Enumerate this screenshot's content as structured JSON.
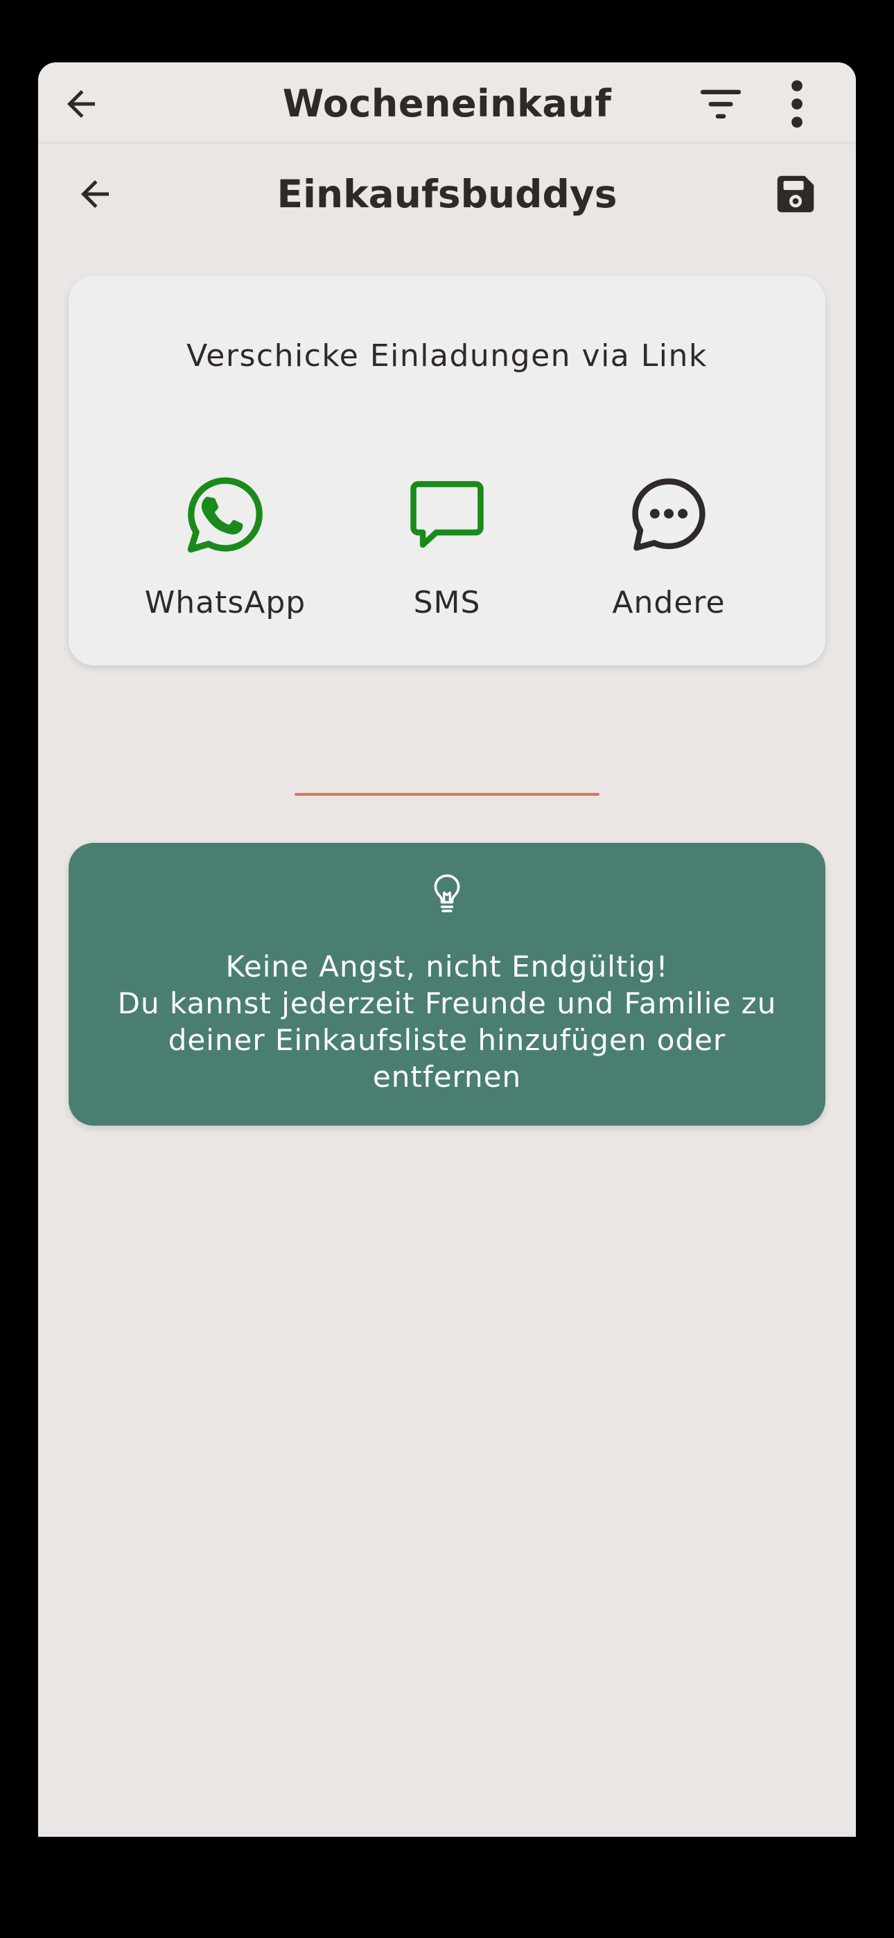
{
  "appbar": {
    "title": "Wocheneinkauf",
    "back_icon": "arrow-left-icon",
    "filter_icon": "filter-icon",
    "menu_icon": "more-vertical-icon"
  },
  "sheet": {
    "title": "Einkaufsbuddys",
    "back_icon": "arrow-left-icon",
    "save_icon": "save-icon"
  },
  "invite": {
    "heading": "Verschicke Einladungen via Link",
    "options": [
      {
        "label": "WhatsApp",
        "icon": "whatsapp-icon",
        "color": "#1a8a1a"
      },
      {
        "label": "SMS",
        "icon": "message-icon",
        "color": "#1a8a1a"
      },
      {
        "label": "Andere",
        "icon": "more-chat-icon",
        "color": "#2f2a27"
      }
    ]
  },
  "tip": {
    "icon": "lightbulb-icon",
    "line1": "Keine Angst, nicht Endgültig!",
    "line2": "Du kannst jederzeit Freunde und Familie zu deiner Einkaufsliste hinzufügen oder entfernen"
  },
  "colors": {
    "background": "#e9e6e3",
    "text": "#2f2a27",
    "tip_card": "#4a7e71",
    "accent_line": "#e2705b",
    "share_green": "#1a8a1a"
  }
}
